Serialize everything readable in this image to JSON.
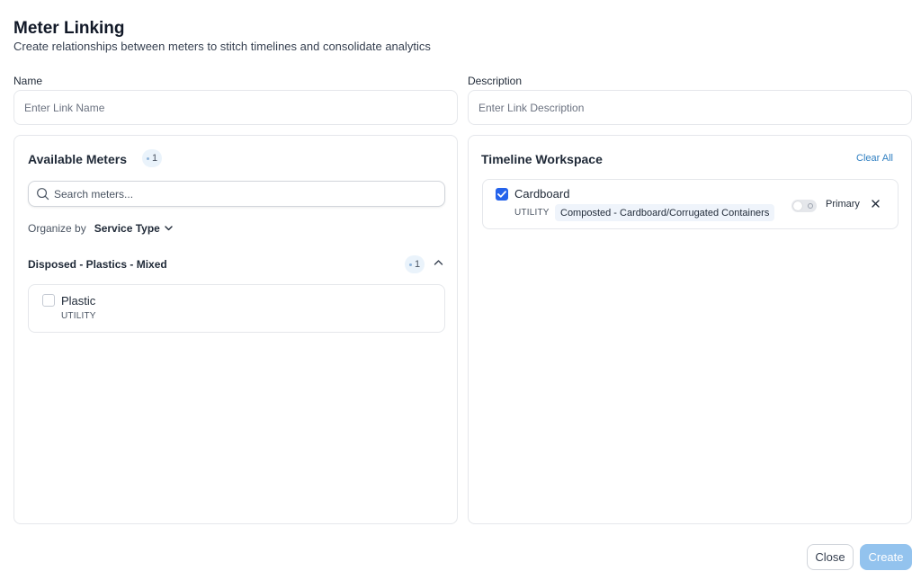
{
  "dialog": {
    "title": "Meter Linking",
    "subtitle": "Create relationships between meters to stitch timelines and consolidate analytics"
  },
  "form": {
    "name_label": "Name",
    "name_placeholder": "Enter Link Name",
    "description_label": "Description",
    "description_placeholder": "Enter Link Description"
  },
  "available": {
    "title": "Available Meters",
    "count": "1",
    "search_placeholder": "Search meters...",
    "organize_label": "Organize by",
    "organize_value": "Service Type",
    "group": {
      "name": "Disposed - Plastics - Mixed",
      "count": "1",
      "items": [
        {
          "name": "Plastic",
          "type": "UTILITY",
          "checked": false
        }
      ]
    }
  },
  "workspace": {
    "title": "Timeline Workspace",
    "clear_all": "Clear All",
    "items": [
      {
        "name": "Cardboard",
        "type": "UTILITY",
        "tag": "Composted - Cardboard/Corrugated Containers",
        "primary_label": "Primary",
        "primary": false,
        "checked": true
      }
    ]
  },
  "footer": {
    "close_label": "Close",
    "create_label": "Create"
  },
  "colors": {
    "accent": "#2563eb",
    "link": "#2f7fc1",
    "create_button": "#93c3ee"
  }
}
